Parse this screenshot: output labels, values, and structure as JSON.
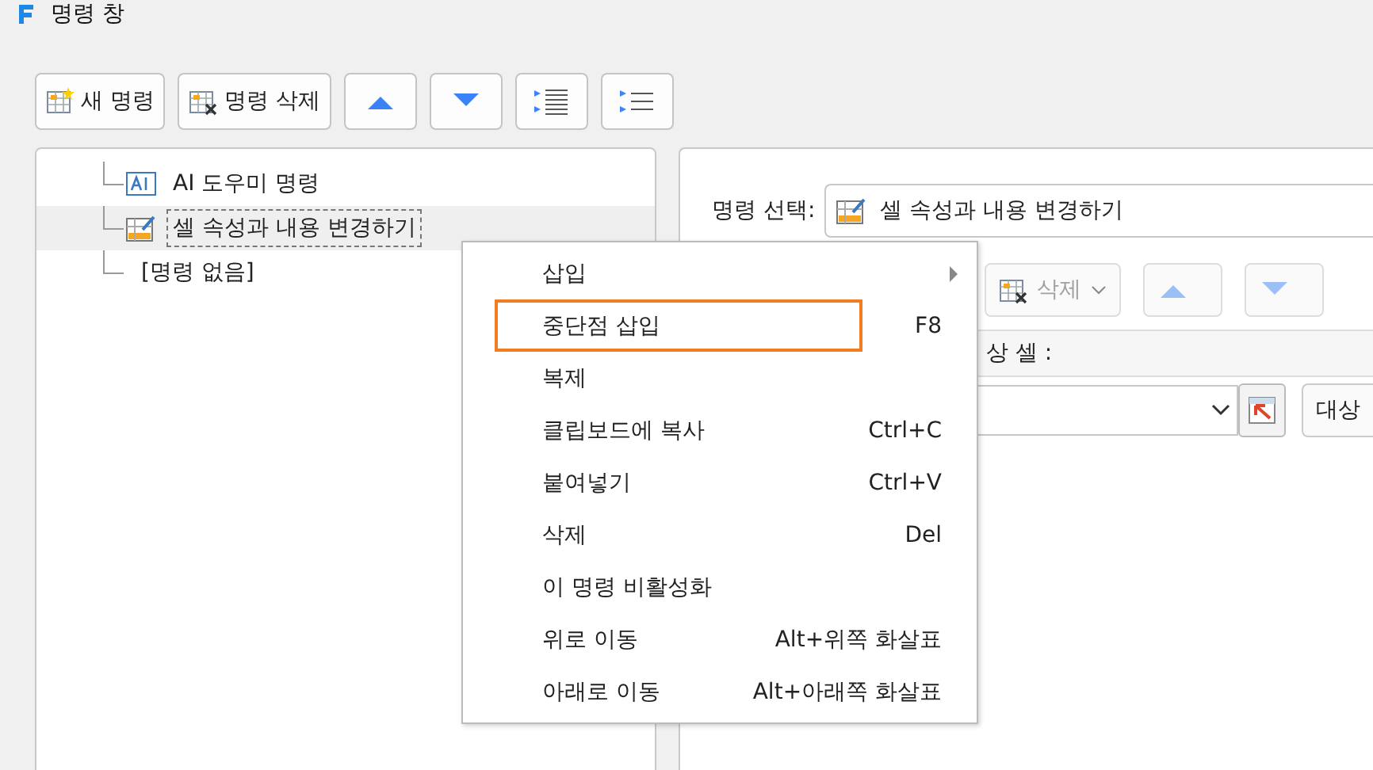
{
  "window": {
    "title": "명령 창"
  },
  "toolbar": [
    {
      "kind": "new",
      "label": "새 명령"
    },
    {
      "kind": "delete",
      "label": "명령 삭제"
    },
    {
      "kind": "up"
    },
    {
      "kind": "down"
    },
    {
      "kind": "indent"
    },
    {
      "kind": "list"
    }
  ],
  "tree": [
    {
      "kind": "ai",
      "label": "AI 도우미 명령",
      "selected": false
    },
    {
      "kind": "cell",
      "label": "셀 속성과 내용 변경하기",
      "selected": true
    },
    {
      "kind": "none",
      "label": "[명령 없음]",
      "selected": false
    }
  ],
  "detail": {
    "command_label": "명령 선택:",
    "command_value": "셀 속성과 내용 변경하기",
    "delete_button": {
      "label": "삭제",
      "disabled": true
    },
    "target_header": "상 셀 :",
    "target_button": "대상"
  },
  "context_menu": [
    {
      "label": "삽입",
      "submenu": true,
      "highlighted": false
    },
    {
      "label": "중단점 삽입",
      "shortcut": "F8",
      "submenu": false,
      "highlighted": true
    },
    {
      "label": "복제",
      "submenu": false,
      "highlighted": false
    },
    {
      "label": "클립보드에 복사",
      "shortcut": "Ctrl+C",
      "submenu": false,
      "highlighted": false
    },
    {
      "label": "붙여넣기",
      "shortcut": "Ctrl+V",
      "submenu": false,
      "highlighted": false
    },
    {
      "label": "삭제",
      "shortcut": "Del",
      "submenu": false,
      "highlighted": false
    },
    {
      "label": "이 명령 비활성화",
      "submenu": false,
      "highlighted": false
    },
    {
      "label": "위로 이동",
      "shortcut": "Alt+위쪽 화살표",
      "submenu": false,
      "highlighted": false
    },
    {
      "label": "아래로 이동",
      "shortcut": "Alt+아래쪽 화살표",
      "submenu": false,
      "highlighted": false
    }
  ]
}
